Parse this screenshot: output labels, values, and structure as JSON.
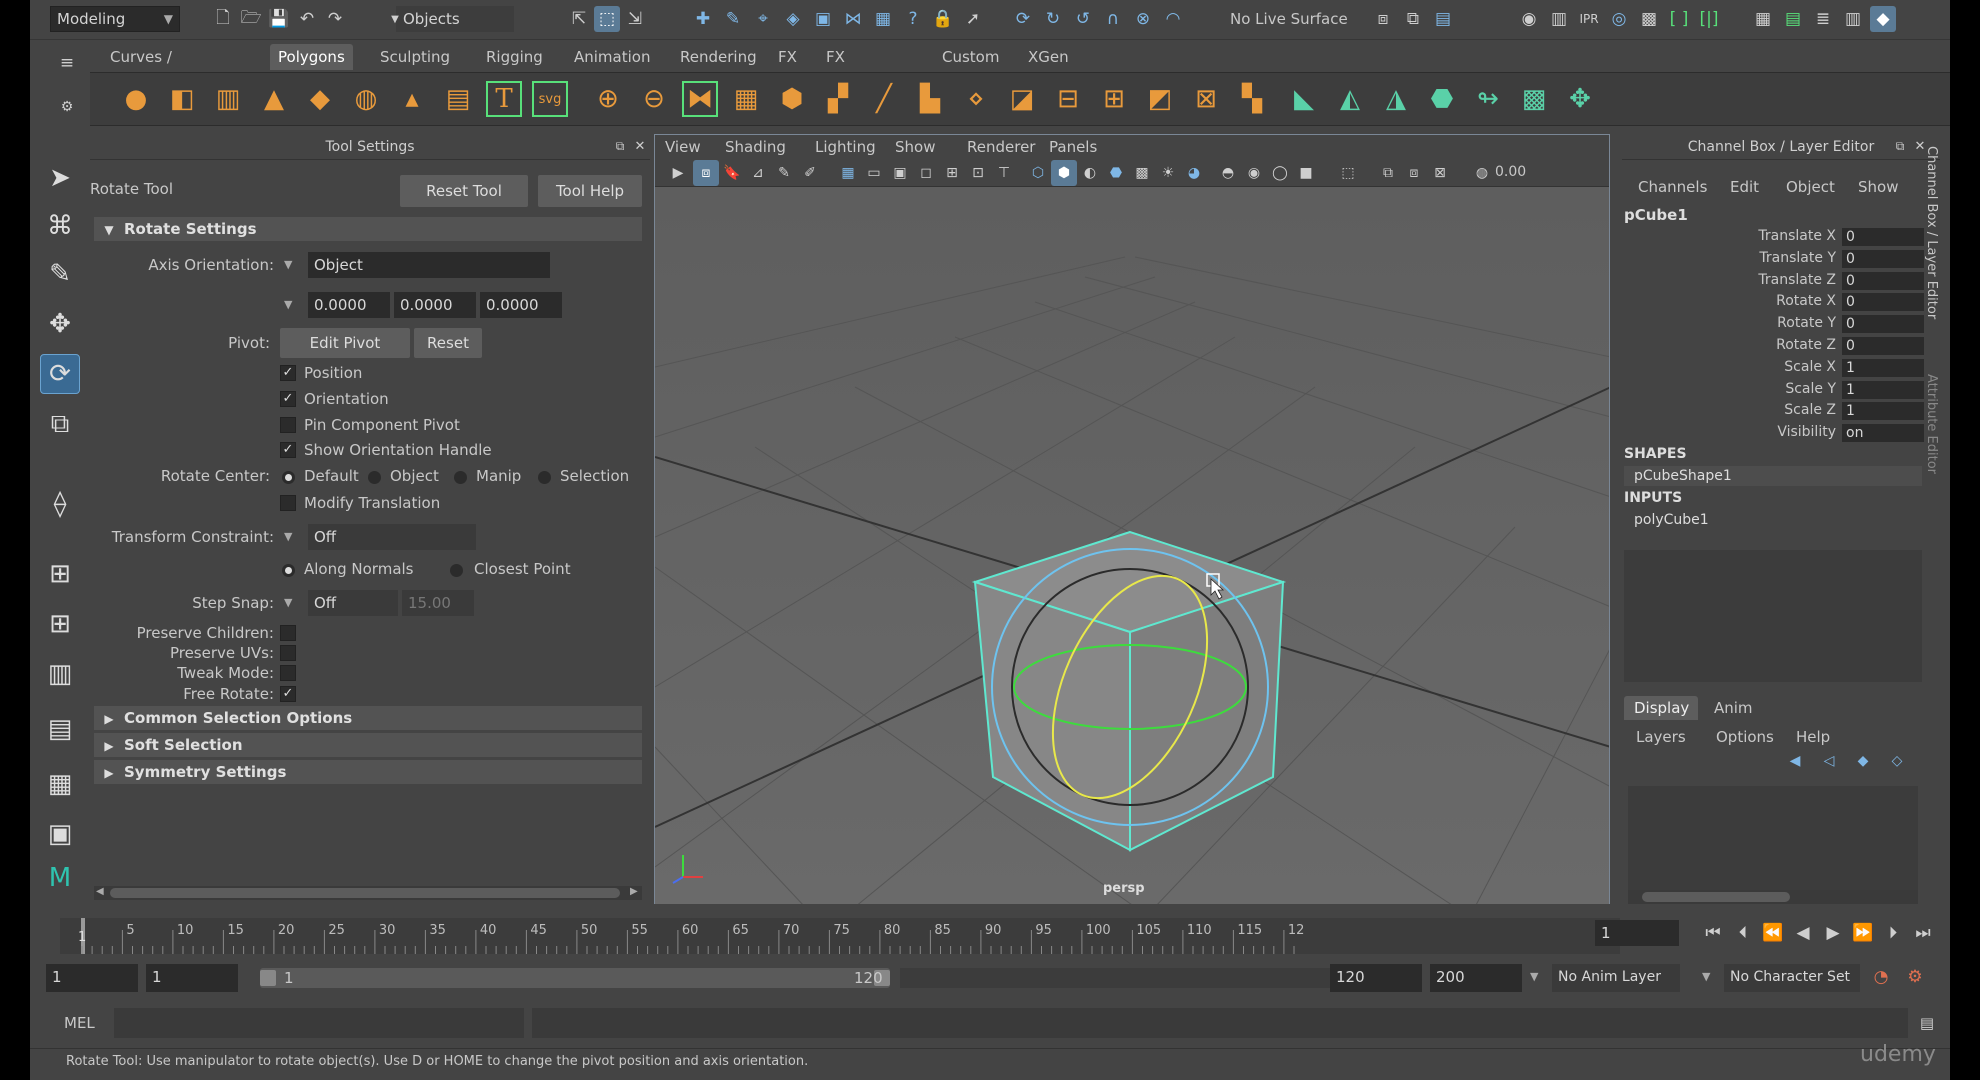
{
  "menuset": {
    "value": "Modeling"
  },
  "selection_mode": {
    "value": "Objects"
  },
  "live_surface": {
    "label": "No Live Surface"
  },
  "shelf_tabs": [
    "Curves / Surfaces",
    "Polygons",
    "Sculpting",
    "Rigging",
    "Animation",
    "Rendering",
    "FX",
    "FX Caching",
    "Custom",
    "XGen"
  ],
  "shelf_active": "Polygons",
  "shelf_icons": {
    "text": "T",
    "svg": "svg"
  },
  "tool_settings": {
    "header": "Tool Settings",
    "tool_name": "Rotate Tool",
    "reset_tool": "Reset Tool",
    "tool_help": "Tool Help",
    "rotate_settings": "Rotate Settings",
    "axis_orientation_label": "Axis Orientation:",
    "axis_orientation_value": "Object",
    "axis_values": [
      "0.0000",
      "0.0000",
      "0.0000"
    ],
    "pivot_label": "Pivot:",
    "edit_pivot": "Edit Pivot",
    "reset": "Reset",
    "position": "Position",
    "orientation": "Orientation",
    "pin_component_pivot": "Pin Component Pivot",
    "show_orientation_handle": "Show Orientation Handle",
    "rotate_center_label": "Rotate Center:",
    "rc_default": "Default",
    "rc_object": "Object",
    "rc_manip": "Manip",
    "rc_selection": "Selection",
    "modify_translation": "Modify Translation",
    "transform_constraint_label": "Transform Constraint:",
    "transform_constraint_value": "Off",
    "along_normals": "Along Normals",
    "closest_point": "Closest Point",
    "step_snap_label": "Step Snap:",
    "step_snap_value": "Off",
    "step_snap_amount": "15.00",
    "preserve_children": "Preserve Children:",
    "preserve_uvs": "Preserve UVs:",
    "tweak_mode": "Tweak Mode:",
    "free_rotate": "Free Rotate:",
    "common_selection": "Common Selection Options",
    "soft_selection": "Soft Selection",
    "symmetry_settings": "Symmetry Settings"
  },
  "viewport": {
    "menus": [
      "View",
      "Shading",
      "Lighting",
      "Show",
      "Renderer",
      "Panels"
    ],
    "exposure": "0.00",
    "camera": "persp"
  },
  "channel_box": {
    "header": "Channel Box / Layer Editor",
    "menus": [
      "Channels",
      "Edit",
      "Object",
      "Show"
    ],
    "object": "pCube1",
    "attributes": [
      {
        "name": "Translate X",
        "value": "0"
      },
      {
        "name": "Translate Y",
        "value": "0"
      },
      {
        "name": "Translate Z",
        "value": "0"
      },
      {
        "name": "Rotate X",
        "value": "0"
      },
      {
        "name": "Rotate Y",
        "value": "0"
      },
      {
        "name": "Rotate Z",
        "value": "0"
      },
      {
        "name": "Scale X",
        "value": "1"
      },
      {
        "name": "Scale Y",
        "value": "1"
      },
      {
        "name": "Scale Z",
        "value": "1"
      },
      {
        "name": "Visibility",
        "value": "on"
      }
    ],
    "shapes_label": "SHAPES",
    "shape": "pCubeShape1",
    "inputs_label": "INPUTS",
    "input": "polyCube1",
    "layer_tabs": [
      "Display",
      "Anim"
    ],
    "layer_menus": [
      "Layers",
      "Options",
      "Help"
    ],
    "side_tab_1": "Channel Box / Layer Editor",
    "side_tab_2": "Attribute Editor"
  },
  "timeline": {
    "ticks": [
      "5",
      "10",
      "15",
      "20",
      "25",
      "30",
      "35",
      "40",
      "45",
      "50",
      "55",
      "60",
      "65",
      "70",
      "75",
      "80",
      "85",
      "90",
      "95",
      "100",
      "105",
      "110",
      "115",
      "12"
    ],
    "current_frame_marker": "1",
    "current_frame": "1"
  },
  "range": {
    "start": "1",
    "playback_start": "1",
    "slider_start": "1",
    "slider_end": "120",
    "playback_end": "120",
    "end": "200",
    "anim_layer": "No Anim Layer",
    "character_set": "No Character Set"
  },
  "command_line": {
    "label": "MEL"
  },
  "help_line": "Rotate Tool: Use manipulator to rotate object(s). Use D or HOME to change the pivot position and axis orientation.",
  "watermark": "udemy"
}
